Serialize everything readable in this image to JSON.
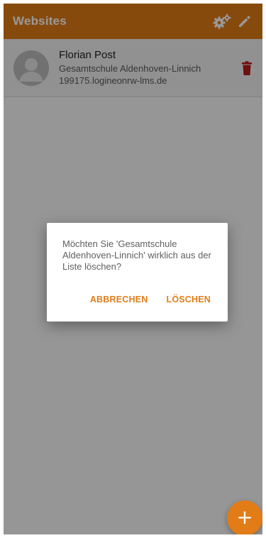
{
  "appbar": {
    "title": "Websites",
    "icons": [
      "settings-gears-icon",
      "edit-pencil-icon"
    ]
  },
  "list": {
    "items": [
      {
        "name": "Florian Post",
        "school": "Gesamtschule Aldenhoven-Linnich",
        "domain": "199175.logineonrw-lms.de",
        "avatar_icon": "default-avatar-icon",
        "action_icon": "trash-icon"
      }
    ]
  },
  "dialog": {
    "message": "Möchten Sie 'Gesamtschule Aldenhoven-Linnich' wirklich aus der Liste löschen?",
    "cancel_label": "ABBRECHEN",
    "confirm_label": "LÖSCHEN"
  },
  "fab": {
    "label": "+",
    "icon": "plus-icon"
  },
  "colors": {
    "accent": "#e17c17",
    "delete": "#b71c1c",
    "scrim": "rgba(0,0,0,0.40)"
  }
}
